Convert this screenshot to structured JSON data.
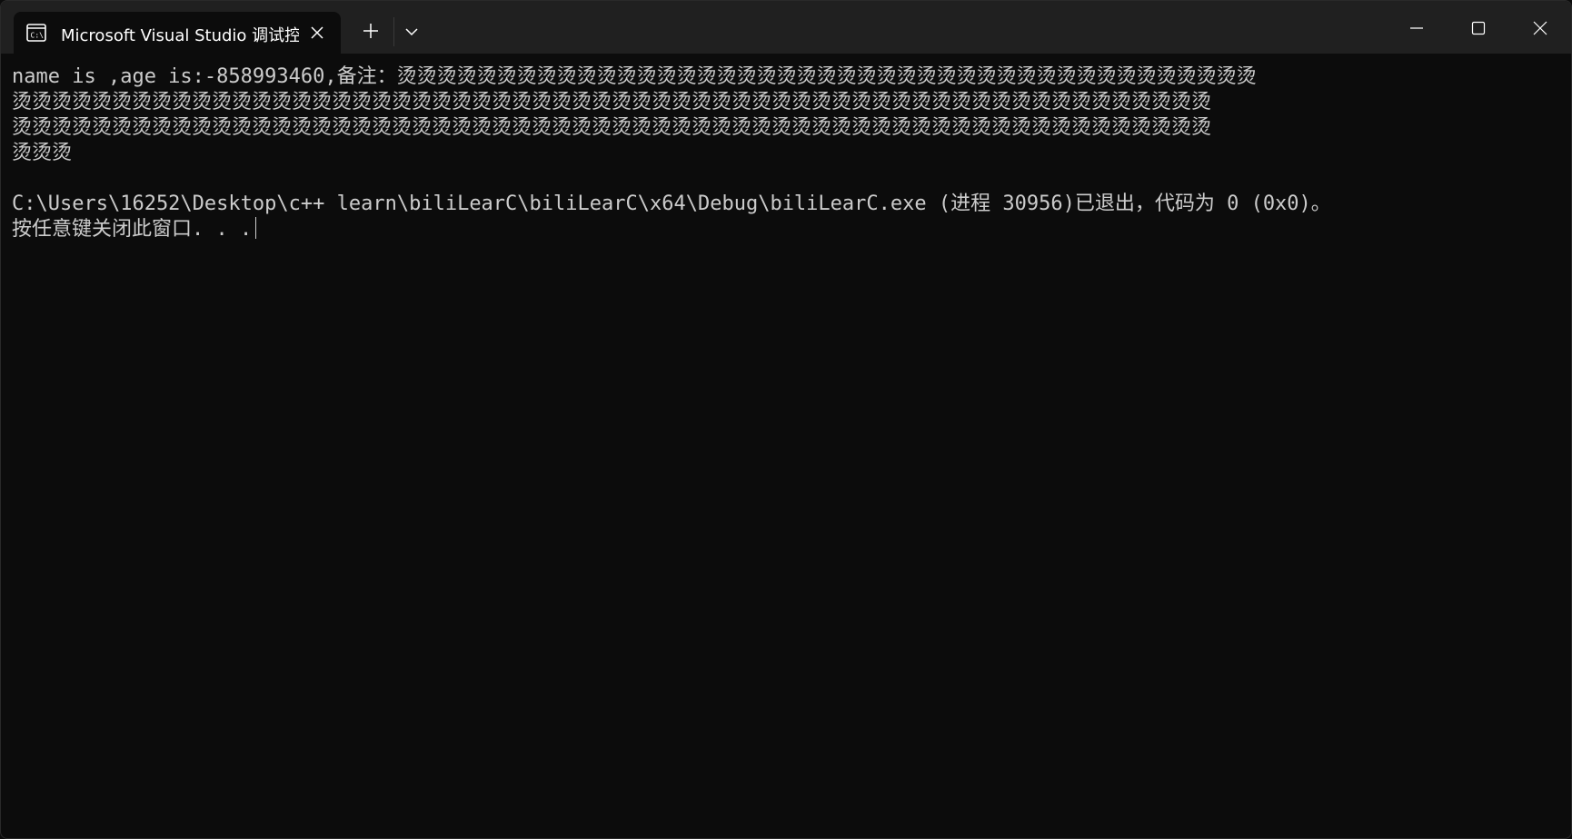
{
  "window": {
    "tab_title": "Microsoft Visual Studio 调试控制台",
    "tab_icon": "console-icon",
    "buttons": {
      "new_tab": "plus-icon",
      "dropdown": "chevron-down-icon",
      "minimize": "minimize-icon",
      "maximize": "maximize-icon",
      "close": "close-icon"
    }
  },
  "console": {
    "lines": [
      "name is ,age is:-858993460,备注：烫烫烫烫烫烫烫烫烫烫烫烫烫烫烫烫烫烫烫烫烫烫烫烫烫烫烫烫烫烫烫烫烫烫烫烫烫烫烫烫烫烫烫",
      "烫烫烫烫烫烫烫烫烫烫烫烫烫烫烫烫烫烫烫烫烫烫烫烫烫烫烫烫烫烫烫烫烫烫烫烫烫烫烫烫烫烫烫烫烫烫烫烫烫烫烫烫烫烫烫烫烫烫烫烫",
      "烫烫烫烫烫烫烫烫烫烫烫烫烫烫烫烫烫烫烫烫烫烫烫烫烫烫烫烫烫烫烫烫烫烫烫烫烫烫烫烫烫烫烫烫烫烫烫烫烫烫烫烫烫烫烫烫烫烫烫烫",
      "烫烫烫",
      "",
      "C:\\Users\\16252\\Desktop\\c++ learn\\biliLearC\\biliLearC\\x64\\Debug\\biliLearC.exe (进程 30956)已退出，代码为 0 (0x0)。",
      "按任意键关闭此窗口. . ."
    ]
  },
  "colors": {
    "background": "#0c0c0c",
    "titlebar": "#202020",
    "text": "#cccccc"
  }
}
